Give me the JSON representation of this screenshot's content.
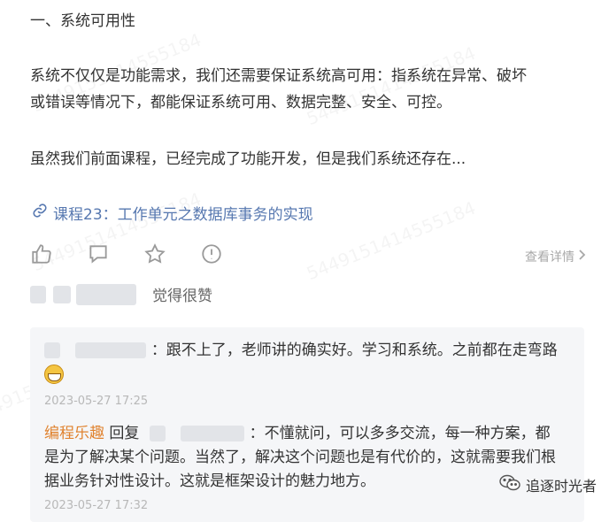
{
  "watermark": "5449151414555184",
  "article": {
    "heading": "一、系统可用性",
    "paragraph1_line1": "系统不仅仅是功能需求，我们还需要保证系统高可用：指系统在异常、破坏",
    "paragraph1_line2": "或错误等情况下，都能保证系统可用、数据完整、安全、可控。",
    "paragraph2": "虽然我们前面课程，已经完成了功能开发，但是我们系统还存在...",
    "link_text": "课程23：工作单元之数据库事务的实现"
  },
  "actions": {
    "icons": [
      "thumb-up-icon",
      "comment-icon",
      "star-icon",
      "report-icon"
    ],
    "detail_label": "查看详情"
  },
  "likes": {
    "text": "觉得很赞"
  },
  "comments": [
    {
      "text": "：跟不上了，老师讲的确实好。学习和系统。之前都在走弯路",
      "time": "2023-05-27 17:25"
    },
    {
      "author": "编程乐趣",
      "reply_label": "回复",
      "text_line1": "：不懂就问，可以多多交流，每一种方案，都",
      "text_line2": "是为了解决某个问题。当然了，解决这个问题也是有代价的，这就需要我们根",
      "text_line3": "据业务针对性设计。这就是框架设计的魅力地方。",
      "time": "2023-05-27 17:32"
    }
  ],
  "brand": {
    "name": "追逐时光者"
  },
  "colors": {
    "link": "#5778b0",
    "author": "#e0822e",
    "comment_bg": "#f5f6f8"
  }
}
